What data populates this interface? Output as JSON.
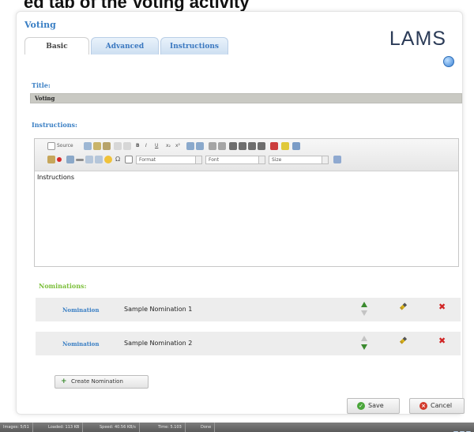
{
  "banner": {
    "text": "ed tab of the Voting activity"
  },
  "page": {
    "title": "Voting",
    "logo": "LAMS"
  },
  "tabs": [
    {
      "label": "Basic",
      "active": true
    },
    {
      "label": "Advanced",
      "active": false
    },
    {
      "label": "Instructions",
      "active": false
    }
  ],
  "form": {
    "title_label": "Title:",
    "title_value": "Voting",
    "instructions_label": "Instructions:",
    "instructions_value": "Instructions"
  },
  "toolbar": {
    "source_label": "Source",
    "format_label": "Format",
    "font_label": "Font",
    "size_label": "Size"
  },
  "nominations": {
    "label": "Nominations:",
    "rows": [
      {
        "link": "Nomination",
        "text": "Sample Nomination 1",
        "up_enabled": true,
        "down_enabled": false
      },
      {
        "link": "Nomination",
        "text": "Sample Nomination 2",
        "up_enabled": false,
        "down_enabled": true
      }
    ]
  },
  "buttons": {
    "create_nomination": "Create Nomination",
    "save": "Save",
    "cancel": "Cancel"
  },
  "statusbar": {
    "segments": [
      "Images: 5/51",
      "Loaded: 113 KB",
      "Speed: 40.56 KB/s",
      "Time: 5.103",
      "Done"
    ]
  },
  "colors": {
    "accent_blue": "#3a7fc4",
    "nominations_green": "#7bbf3a",
    "delete_red": "#d02424"
  }
}
